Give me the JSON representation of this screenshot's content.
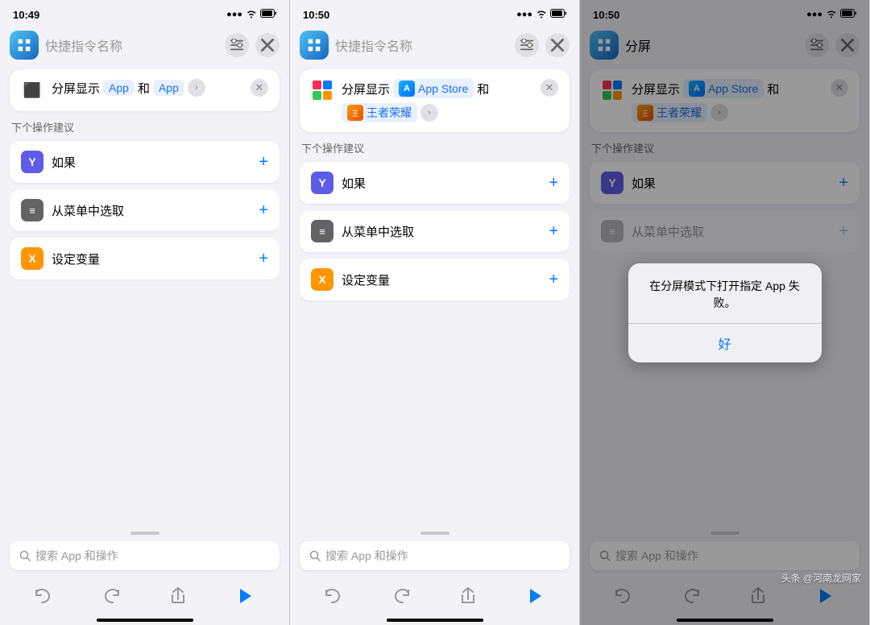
{
  "panels": [
    {
      "id": "panel1",
      "status": {
        "time": "10:49",
        "signal": "●●●",
        "wifi": "▾",
        "battery": "▮"
      },
      "topbar": {
        "shortcut_name_placeholder": "快捷指令名称",
        "is_filled": false
      },
      "action_card": {
        "label": "分屏显示",
        "app1": "App",
        "app2": "App",
        "show_chevron": true
      },
      "next_actions_label": "下个操作建议",
      "suggestions": [
        {
          "icon": "Y",
          "icon_bg": "#5e5ce6",
          "label": "如果"
        },
        {
          "icon": "≡",
          "icon_bg": "#636366",
          "label": "从菜单中选取"
        },
        {
          "icon": "X",
          "icon_bg": "#ff9500",
          "label": "设定变量"
        }
      ],
      "search_placeholder": "搜索 App 和操作",
      "toolbar": {
        "undo": "↩",
        "redo": "↪",
        "share": "↑",
        "play": "▶"
      }
    },
    {
      "id": "panel2",
      "status": {
        "time": "10:50",
        "signal": "●●●",
        "wifi": "▾",
        "battery": "▮"
      },
      "topbar": {
        "shortcut_name_placeholder": "快捷指令名称",
        "is_filled": false
      },
      "action_card": {
        "label": "分屏显示",
        "app1_name": "App Store",
        "app2_name": "王者荣耀",
        "show_chevron": true
      },
      "next_actions_label": "下个操作建议",
      "suggestions": [
        {
          "icon": "Y",
          "icon_bg": "#5e5ce6",
          "label": "如果"
        },
        {
          "icon": "≡",
          "icon_bg": "#636366",
          "label": "从菜单中选取"
        },
        {
          "icon": "X",
          "icon_bg": "#ff9500",
          "label": "设定变量"
        }
      ],
      "search_placeholder": "搜索 App 和操作",
      "toolbar": {
        "undo": "↩",
        "redo": "↪",
        "share": "↑",
        "play": "▶"
      }
    },
    {
      "id": "panel3",
      "status": {
        "time": "10:50",
        "signal": "●●●",
        "wifi": "▾",
        "battery": "▮"
      },
      "topbar": {
        "shortcut_name": "分屏",
        "is_filled": true
      },
      "action_card": {
        "label": "分屏显示",
        "app1_name": "App Store",
        "app2_name": "王者荣耀",
        "show_chevron": true
      },
      "next_actions_label": "下个操作建议",
      "suggestions": [
        {
          "icon": "Y",
          "icon_bg": "#5e5ce6",
          "label": "如果"
        },
        {
          "icon": "≡",
          "icon_bg": "#636366",
          "label": "从菜单中选取"
        }
      ],
      "search_placeholder": "搜索 App 和操作",
      "toolbar": {
        "undo": "↩",
        "redo": "↪",
        "share": "↑",
        "play": "▶"
      },
      "alert": {
        "message": "在分屏模式下打开指定 App 失败。",
        "button": "好"
      },
      "watermark": "头条 @河南龙网家"
    }
  ]
}
